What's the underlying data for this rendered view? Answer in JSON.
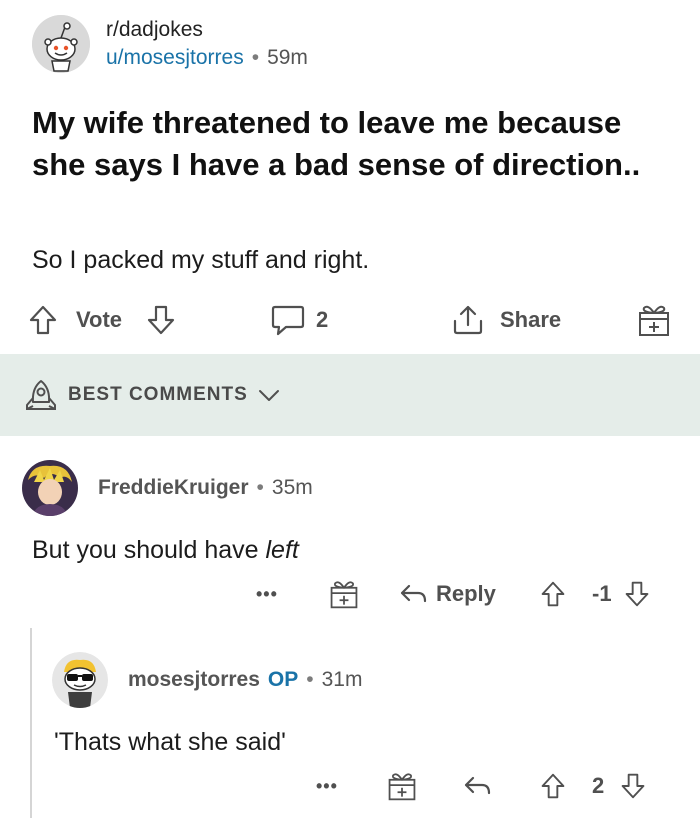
{
  "post": {
    "subreddit": "r/dadjokes",
    "author": "u/mosesjtorres",
    "separator": "•",
    "age": "59m",
    "title": "My wife threatened to leave me because she says I have a bad sense of direction..",
    "body": "So I packed my stuff and right.",
    "actions": {
      "vote_label": "Vote",
      "comment_count": "2",
      "share_label": "Share"
    }
  },
  "comments_header": {
    "sort_label": "BEST COMMENTS"
  },
  "comments": [
    {
      "author": "FreddieKruiger",
      "separator": "•",
      "age": "35m",
      "text_plain": "But you should have ",
      "text_italic": "left",
      "more": "•••",
      "reply_label": "Reply",
      "score": "-1"
    },
    {
      "author": "mosesjtorres",
      "op_badge": "OP",
      "separator": "•",
      "age": "31m",
      "text": "'Thats what she said'",
      "more": "•••",
      "score": "2"
    }
  ],
  "colors": {
    "link_blue": "#1a73a8",
    "band_bg": "#e5ede9",
    "icon_gray": "#505050"
  }
}
